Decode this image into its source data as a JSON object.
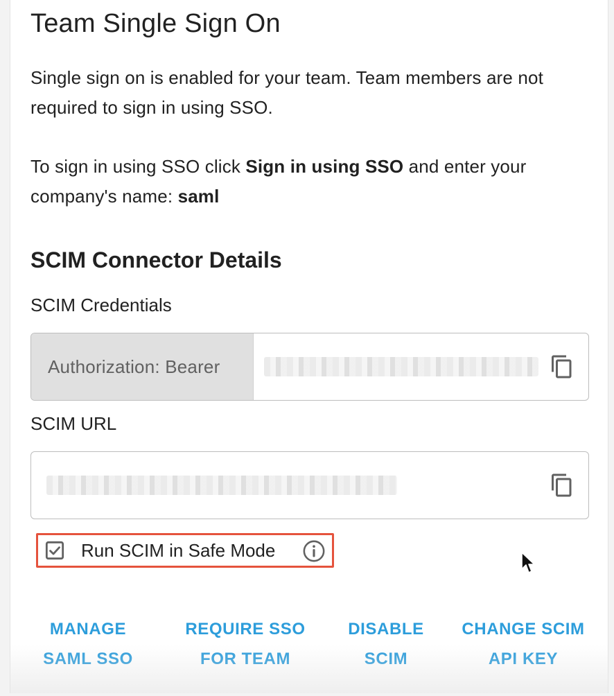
{
  "title": "Team Single Sign On",
  "intro": {
    "line1": "Single sign on is enabled for your team. Team members are not required to sign in using SSO."
  },
  "instructions": {
    "prefix": "To sign in using SSO click ",
    "bold_action": "Sign in using SSO",
    "middle": " and enter your company's name: ",
    "company": "saml"
  },
  "scim": {
    "section_title": "SCIM Connector Details",
    "credentials_label": "SCIM Credentials",
    "auth_prefix": "Authorization: Bearer",
    "url_label": "SCIM URL"
  },
  "safe_mode": {
    "label": "Run SCIM in Safe Mode",
    "checked": true
  },
  "actions": {
    "manage_line1": "MANAGE",
    "manage_line2": "SAML SSO",
    "require_line1": "REQUIRE SSO",
    "require_line2": "FOR TEAM",
    "disable_line1": "DISABLE",
    "disable_line2": "SCIM",
    "change_line1": "CHANGE SCIM",
    "change_line2": "API KEY"
  },
  "icons": {
    "copy": "copy-icon",
    "checkbox": "checkbox-checked-icon",
    "info": "info-icon",
    "cursor": "mouse-cursor-icon"
  },
  "colors": {
    "accent": "#2d9ddb",
    "highlight": "#e5533d",
    "addon_bg": "#e0e0e0"
  }
}
